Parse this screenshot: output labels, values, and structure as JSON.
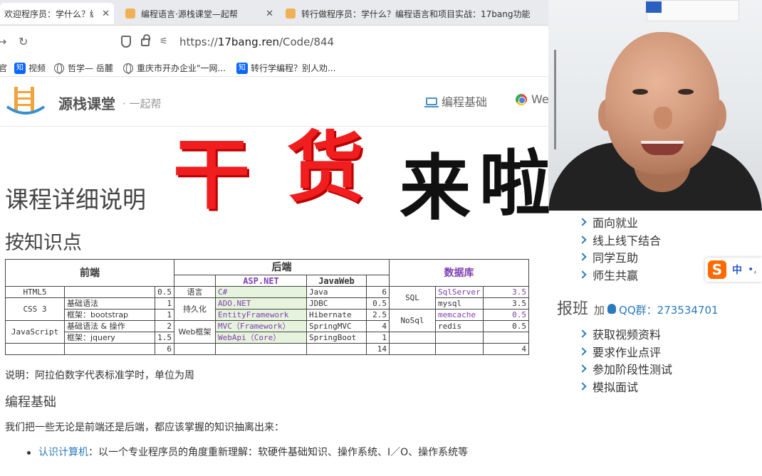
{
  "browser": {
    "tabs": [
      {
        "label": "欢迎程序员：学什么？编程语",
        "active": true
      },
      {
        "label": "编程语言·源栈课堂—起帮",
        "active": false
      },
      {
        "label": "转行做程序员：学什么？编程语言和项目实战：17bang功能",
        "active": false
      }
    ],
    "url_prefix": "https://",
    "url_domain": "17bang.ren",
    "url_path": "/Code/844",
    "bookmarks": [
      {
        "label": "官",
        "icon": "none"
      },
      {
        "label": "视频",
        "icon": "zhihu-icon"
      },
      {
        "label": "哲学— 岳麓",
        "icon": "globe-icon"
      },
      {
        "label": "重庆市开办企业\"一网...",
        "icon": "globe-icon"
      },
      {
        "label": "转行学编程？别人劝...",
        "icon": "zhihu-icon"
      }
    ]
  },
  "site": {
    "name": "源栈课堂",
    "sub": "· 一起帮",
    "nav": [
      {
        "label": "编程基础",
        "icon": "laptop-icon"
      },
      {
        "label": "We",
        "icon": "chrome-icon"
      }
    ]
  },
  "overlay": {
    "title_part1": "干",
    "title_part2": "货",
    "title_part3": "来",
    "title_part4": "啦"
  },
  "content": {
    "h1": "课程详细说明",
    "h2": "按知识点",
    "note": "说明：阿拉伯数字代表标准学时，单位为周",
    "h3": "编程基础",
    "para": "我们把一些无论是前端还是后端，都应该掌握的知识抽离出来：",
    "bullet_link": "认识计算机",
    "bullet_text": "：以一个专业程序员的角度重新理解：软硬件基础知识、操作系统、I／O、操作系统等"
  },
  "table": {
    "header_frontend": "前端",
    "header_backend": "后端",
    "header_db": "数据库",
    "sub_aspnet": "ASP.NET",
    "sub_javaweb": "JavaWeb",
    "rows": [
      {
        "fe_a": "HTML5",
        "fe_b": "",
        "fe_n": "0.5",
        "be_cat": "语言",
        "asp": "C#",
        "java": "Java",
        "be_n": "6",
        "db_cat": "SQL",
        "db_a": "SqlServer",
        "db_n": "3.5"
      },
      {
        "fe_a": "CSS 3",
        "fe_b": "基础语法",
        "fe_n": "1",
        "be_cat": "持久化",
        "asp": "ADO.NET",
        "java": "JDBC",
        "be_n": "0.5",
        "db_cat": "",
        "db_a": "mysql",
        "db_n": "3.5"
      },
      {
        "fe_a": "",
        "fe_b": "框架：bootstrap",
        "fe_n": "1",
        "be_cat": "",
        "asp": "EntityFramework",
        "java": "Hibernate",
        "be_n": "2.5",
        "db_cat": "NoSql",
        "db_a": "memcache",
        "db_n": "0.5"
      },
      {
        "fe_a": "JavaScript",
        "fe_b": "基础语法 & 操作",
        "fe_n": "2",
        "be_cat": "Web框架",
        "asp": "MVC（Framework）",
        "java": "SpringMVC",
        "be_n": "4",
        "db_cat": "",
        "db_a": "redis",
        "db_n": "0.5"
      },
      {
        "fe_a": "",
        "fe_b": "框架：jquery",
        "fe_n": "1.5",
        "be_cat": "",
        "asp": "WebApi（Core）",
        "java": "SpringBoot",
        "be_n": "1",
        "db_cat": "",
        "db_a": "",
        "db_n": ""
      }
    ],
    "total_fe": "6",
    "total_be": "14",
    "total_db": "4"
  },
  "sidebar": {
    "benefits": [
      "面向就业",
      "线上线下结合",
      "同学互助",
      "师生共赢"
    ],
    "enroll_title": "报班",
    "enroll_add": "加",
    "qq_group": "QQ群：273534701",
    "perks": [
      "获取视频资料",
      "要求作业点评",
      "参加阶段性测试",
      "模拟面试"
    ]
  },
  "ime": {
    "logo": "S",
    "mode": "中",
    "punct": "•,"
  },
  "colors": {
    "accent": "#2a7bbd",
    "overlay_red": "#f01e1e",
    "db_purple": "#8040b0",
    "cell_green": "#e6f4dd"
  }
}
